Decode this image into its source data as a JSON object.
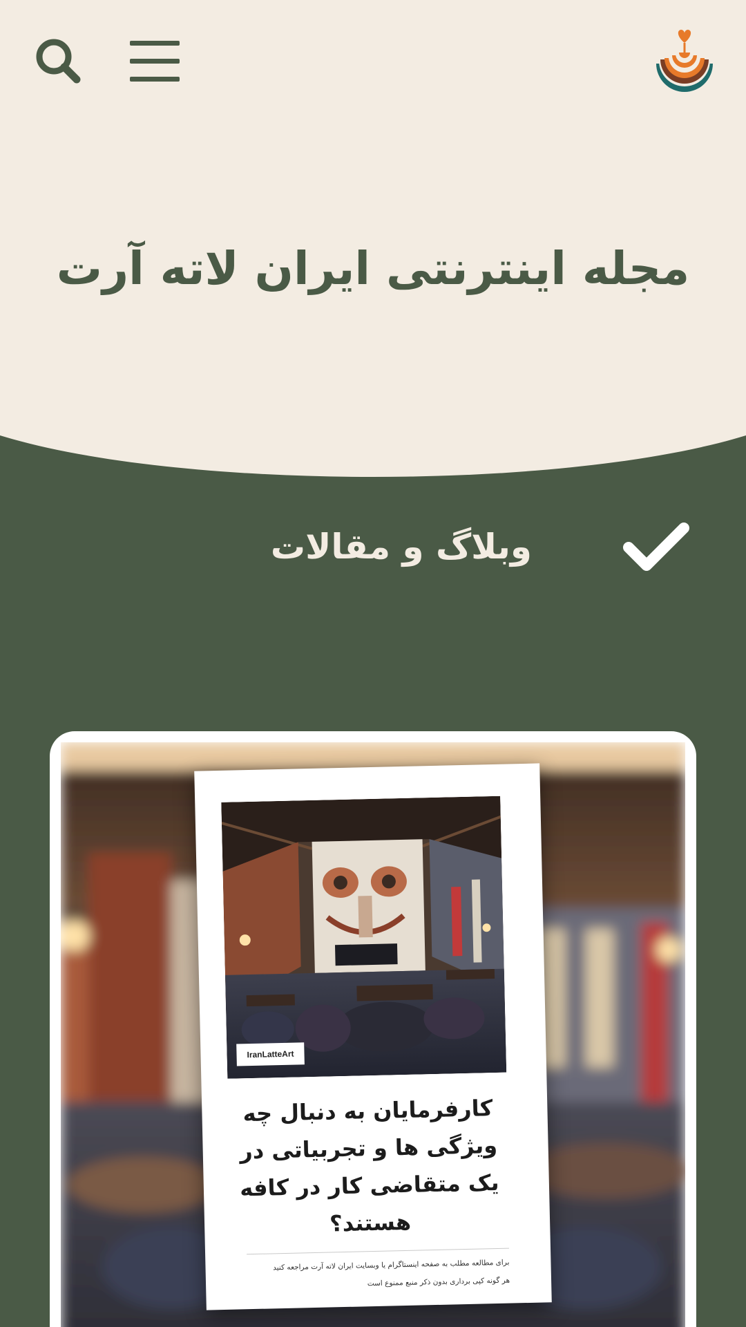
{
  "header": {
    "search_icon": "search-icon",
    "menu_icon": "hamburger-menu-icon",
    "logo_icon": "latte-art-heart-logo",
    "title": "مجله اینترنتی ایران لاته آرت"
  },
  "section": {
    "title": "وبلاگ و مقالات",
    "icon": "checkmark-icon"
  },
  "featured_post": {
    "brand": "IranLatteArt",
    "headline": "کارفرمایان به دنبال چه ویژگی ها و تجربیاتی در یک متقاضی کار در کافه هستند؟",
    "footnote_line1": "برای مطالعه مطلب به صفحه اینستاگرام یا وبسایت ایران لاته آرت مراجعه کنید",
    "footnote_line2": "هر گونه کپی برداری بدون ذکر منبع ممنوع است"
  },
  "colors": {
    "cream": "#f3ece2",
    "olive": "#4a5a46",
    "logo_orange": "#e77a2a",
    "logo_teal": "#1f6b6b"
  }
}
